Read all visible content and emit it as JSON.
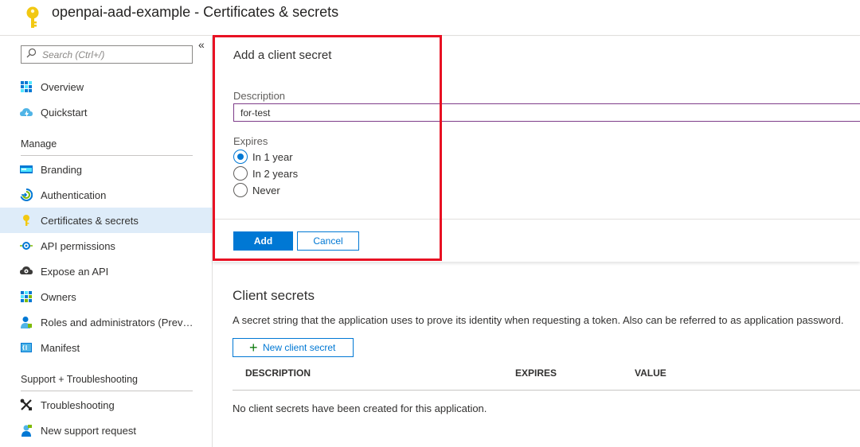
{
  "header": {
    "title": "openpai-aad-example - Certificates & secrets",
    "icon": "key-icon"
  },
  "sidebar": {
    "collapse_glyph": "«",
    "search_placeholder": "Search (Ctrl+/)",
    "items": [
      {
        "label": "Overview",
        "icon": "overview-grid-icon"
      },
      {
        "label": "Quickstart",
        "icon": "quickstart-cloud-icon"
      }
    ],
    "manage_title": "Manage",
    "manage_items": [
      {
        "label": "Branding",
        "icon": "branding-icon"
      },
      {
        "label": "Authentication",
        "icon": "authentication-icon"
      },
      {
        "label": "Certificates & secrets",
        "icon": "key-icon",
        "active": true
      },
      {
        "label": "API permissions",
        "icon": "api-permissions-icon"
      },
      {
        "label": "Expose an API",
        "icon": "cloud-gear-icon"
      },
      {
        "label": "Owners",
        "icon": "owners-grid-icon"
      },
      {
        "label": "Roles and administrators (Previ...",
        "icon": "person-badge-icon"
      },
      {
        "label": "Manifest",
        "icon": "manifest-icon"
      }
    ],
    "support_title": "Support + Troubleshooting",
    "support_items": [
      {
        "label": "Troubleshooting",
        "icon": "wrench-icon"
      },
      {
        "label": "New support request",
        "icon": "support-person-icon"
      }
    ]
  },
  "panel": {
    "title": "Add a client secret",
    "description_label": "Description",
    "description_value": "for-test",
    "expires_label": "Expires",
    "expires_options": [
      "In 1 year",
      "In 2 years",
      "Never"
    ],
    "expires_selected": "In 1 year",
    "add_label": "Add",
    "cancel_label": "Cancel"
  },
  "client_secrets": {
    "title": "Client secrets",
    "description": "A secret string that the application uses to prove its identity when requesting a token. Also can be referred to as application password.",
    "new_button_label": "New client secret",
    "columns": [
      "DESCRIPTION",
      "EXPIRES",
      "VALUE"
    ],
    "empty_message": "No client secrets have been created for this application."
  },
  "colors": {
    "accent": "#0078d4",
    "highlight": "#e81123",
    "active_bg": "#deecf9",
    "input_border": "#7e3c8a"
  }
}
